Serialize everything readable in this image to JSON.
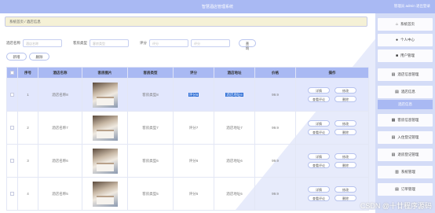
{
  "header": {
    "title": "智慧酒店管理系统",
    "user": "管理员 admin  退出登录"
  },
  "breadcrumb": {
    "home": "系统首页",
    "separator": "/",
    "current": "酒店信息"
  },
  "search": {
    "name_label": "酒店名称",
    "name_placeholder": "酒店名称",
    "type_label": "客房类型",
    "type_placeholder": "客房类型",
    "rating_label": "评分",
    "rating_placeholder": "评分",
    "rating_placeholder_2": "评分",
    "query_button": "查询"
  },
  "actions": {
    "add_button": "新增",
    "delete_button": "删除"
  },
  "table": {
    "headers": [
      "",
      "序号",
      "酒店名称",
      "客房图片",
      "客房类型",
      "评分",
      "酒店地址",
      "价格",
      "操作"
    ],
    "rows": [
      {
        "index": "1",
        "name": "酒店名称8",
        "type": "客房类型8",
        "rating": "评分8",
        "address": "酒店地址8",
        "price": "99.9"
      },
      {
        "index": "2",
        "name": "酒店名称7",
        "type": "客房类型7",
        "rating": "评分7",
        "address": "酒店地址7",
        "price": "99.9"
      },
      {
        "index": "3",
        "name": "酒店名称6",
        "type": "客房类型6",
        "rating": "评分6",
        "address": "酒店地址6",
        "price": "99.9"
      },
      {
        "index": "4",
        "name": "酒店名称5",
        "type": "客房类型5",
        "rating": "评分5",
        "address": "酒店地址5",
        "price": "99.9"
      }
    ],
    "op": {
      "detail": "详情",
      "edit": "修改",
      "review": "查看评论",
      "delete": "删除"
    }
  },
  "sidebar": {
    "items": [
      {
        "label": "系统首页",
        "icon": "home-icon",
        "glyph": "⌂"
      },
      {
        "label": "个人中心",
        "icon": "user-icon",
        "glyph": "●"
      },
      {
        "label": "用户管理",
        "icon": "users-icon",
        "glyph": "■"
      },
      {
        "label": "酒店信息管理",
        "icon": "building-icon",
        "glyph": "▤"
      },
      {
        "label": "酒店信息",
        "icon": "list-icon",
        "glyph": "▤"
      },
      {
        "label": "客房信息管理",
        "icon": "bed-icon",
        "glyph": "▦"
      },
      {
        "label": "入住登记管理",
        "icon": "checkin-icon",
        "glyph": "▤"
      },
      {
        "label": "退房登记管理",
        "icon": "checkout-icon",
        "glyph": "▤"
      },
      {
        "label": "系统管理",
        "icon": "settings-icon",
        "glyph": "▥"
      },
      {
        "label": "订单管理",
        "icon": "order-icon",
        "glyph": "▤"
      }
    ],
    "active_sub": "酒店信息"
  },
  "watermark": "CSDN @十廿程序源码"
}
